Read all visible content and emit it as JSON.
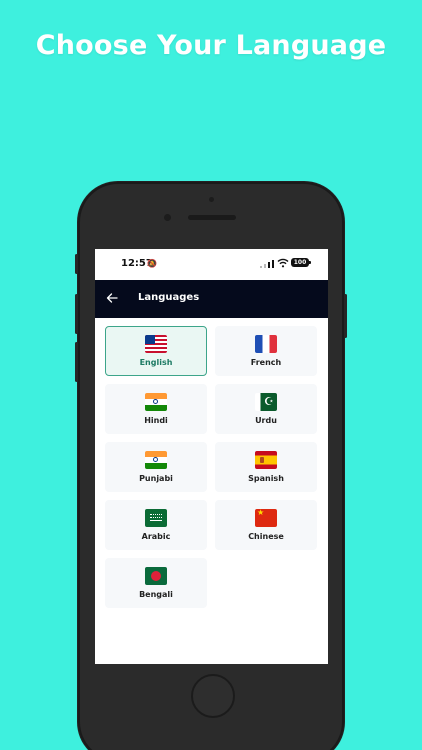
{
  "headline": "Choose Your Language",
  "status_bar": {
    "time": "12:57",
    "battery": "100"
  },
  "app_bar": {
    "title": "Languages"
  },
  "languages": [
    {
      "label": "English",
      "flag": "us-flag-icon",
      "selected": true
    },
    {
      "label": "French",
      "flag": "france-flag-icon",
      "selected": false
    },
    {
      "label": "Hindi",
      "flag": "india-flag-icon",
      "selected": false
    },
    {
      "label": "Urdu",
      "flag": "pakistan-flag-icon",
      "selected": false
    },
    {
      "label": "Punjabi",
      "flag": "india-flag-icon",
      "selected": false
    },
    {
      "label": "Spanish",
      "flag": "spain-flag-icon",
      "selected": false
    },
    {
      "label": "Arabic",
      "flag": "saudi-arabia-flag-icon",
      "selected": false
    },
    {
      "label": "Chinese",
      "flag": "china-flag-icon",
      "selected": false
    },
    {
      "label": "Bengali",
      "flag": "bangladesh-flag-icon",
      "selected": false
    }
  ],
  "colors": {
    "background": "#3ef0de",
    "app_bar": "#050a1c",
    "selected_border": "#3da58a",
    "selected_fill": "#eaf7f3"
  }
}
